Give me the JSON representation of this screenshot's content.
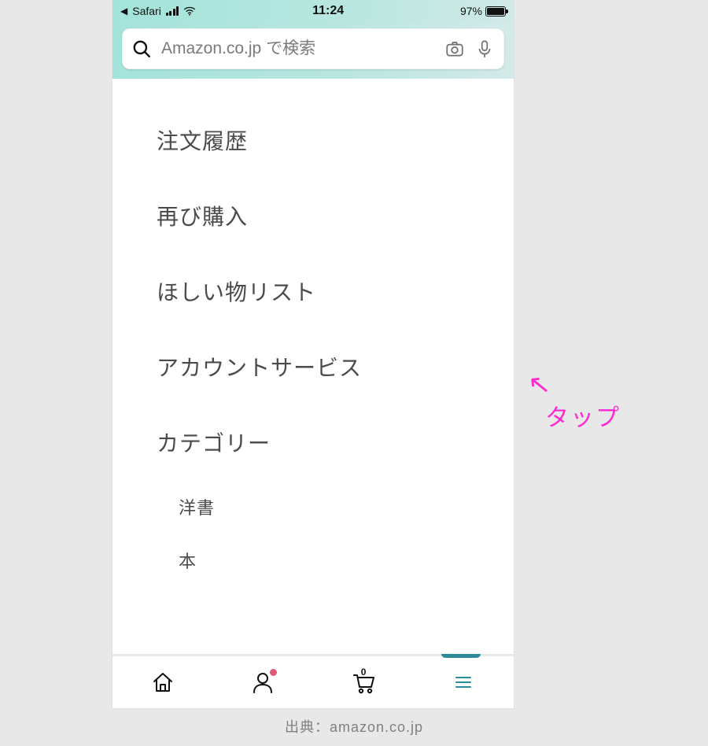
{
  "statusbar": {
    "back_app": "Safari",
    "time": "11:24",
    "battery_pct": "97%"
  },
  "search": {
    "placeholder": "Amazon.co.jp で検索"
  },
  "menu": {
    "items": [
      "注文履歴",
      "再び購入",
      "ほしい物リスト",
      "アカウントサービス",
      "カテゴリー"
    ],
    "sub_items": [
      "洋書",
      "本"
    ]
  },
  "cart_count": "0",
  "annotation": {
    "arrow": "↖",
    "label": "タップ"
  },
  "caption": "出典：amazon.co.jp"
}
